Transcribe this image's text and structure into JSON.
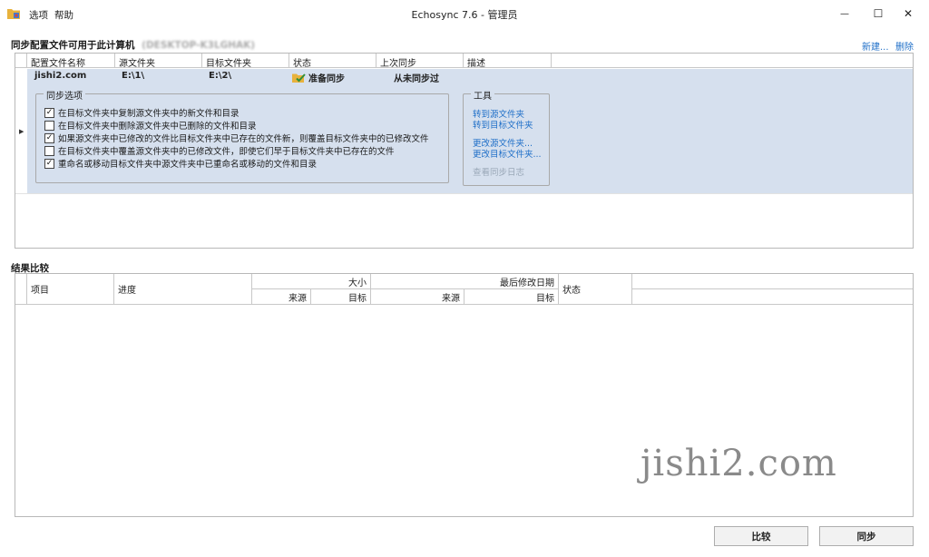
{
  "window": {
    "title": "Echosync 7.6 - 管理员",
    "menu": [
      "选项",
      "帮助"
    ],
    "controls": {
      "minimize": "—",
      "maximize": "☐",
      "close": "✕"
    }
  },
  "profiles_section": {
    "title": "同步配置文件可用于此计算机",
    "computer_name": "(DESKTOP-K3LGHAK)",
    "new_link": "新建...",
    "delete_link": "删除"
  },
  "profiles_table": {
    "columns": [
      "配置文件名称",
      "源文件夹",
      "目标文件夹",
      "状态",
      "上次同步",
      "描述"
    ],
    "row": {
      "name": "jishi2.com",
      "source": "E:\\1\\",
      "target": "E:\\2\\",
      "status": "准备同步",
      "last_sync": "从未同步过",
      "description": ""
    }
  },
  "sync_options": {
    "legend": "同步选项",
    "items": [
      {
        "label": "在目标文件夹中复制源文件夹中的新文件和目录",
        "checked": true
      },
      {
        "label": "在目标文件夹中删除源文件夹中已删除的文件和目录",
        "checked": false
      },
      {
        "label": "如果源文件夹中已修改的文件比目标文件夹中已存在的文件新，则覆盖目标文件夹中的已修改文件",
        "checked": true
      },
      {
        "label": "在目标文件夹中覆盖源文件夹中的已修改文件，即使它们早于目标文件夹中已存在的文件",
        "checked": false
      },
      {
        "label": "重命名或移动目标文件夹中源文件夹中已重命名或移动的文件和目录",
        "checked": true
      }
    ]
  },
  "tools": {
    "legend": "工具",
    "items": [
      {
        "label": "转到源文件夹",
        "enabled": true
      },
      {
        "label": "转到目标文件夹",
        "enabled": true
      },
      {
        "label": "更改源文件夹...",
        "enabled": true
      },
      {
        "label": "更改目标文件夹...",
        "enabled": true
      },
      {
        "label": "查看同步日志",
        "enabled": false
      }
    ]
  },
  "results_section": {
    "title": "结果比较",
    "columns": {
      "item": "项目",
      "progress": "进度",
      "size": "大小",
      "size_source": "来源",
      "size_target": "目标",
      "modified": "最后修改日期",
      "modified_source": "来源",
      "modified_target": "目标",
      "status": "状态"
    }
  },
  "watermark": "jishi2.com",
  "buttons": {
    "compare": "比较",
    "sync": "同步"
  },
  "colors": {
    "selection": "#d6e0ee",
    "link": "#1f6fc8"
  }
}
